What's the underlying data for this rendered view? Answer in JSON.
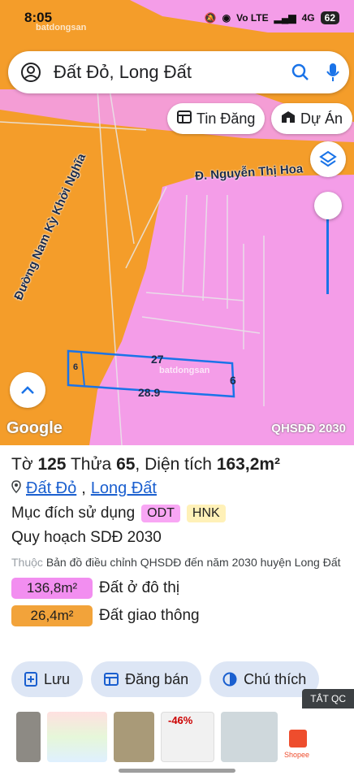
{
  "status_bar": {
    "time": "8:05",
    "network": "Vo LTE",
    "signal": "4G",
    "battery": "62"
  },
  "search": {
    "query": "Đất Đỏ, Long Đất"
  },
  "chips": {
    "listings": "Tin Đăng",
    "projects": "Dự Án"
  },
  "map": {
    "street_1": "Đ. Nguyễn Thị Hoa",
    "street_2": "Đường Nam Kỳ Khởi Nghĩa",
    "dim_top": "27",
    "dim_bottom": "28.9",
    "dim_right": "6",
    "dim_left": "6",
    "watermark": "batdongsan",
    "google": "Google",
    "source": "QHSDĐ 2030",
    "colors": {
      "urban_land": "#f49de8",
      "transport_land": "#f49d2a",
      "parcel_outline": "#1a73e8"
    }
  },
  "parcel": {
    "sheet_label": "Tờ",
    "sheet": "125",
    "plot_label": "Thửa",
    "plot": "65",
    "area_label": "Diện tích",
    "area": "163,2m²",
    "district": "Đất Đỏ",
    "town": "Long Đất",
    "purpose_label": "Mục đích sử dụng",
    "purpose_tags": [
      "ODT",
      "HNK"
    ],
    "plan_title": "Quy hoạch SDĐ 2030",
    "note_prefix": "Thuộc",
    "note": "Bản đồ điều chỉnh QHSDĐ đến năm 2030 huyện Long Đất",
    "areas": [
      {
        "value": "136,8m²",
        "label": "Đất ở đô thị"
      },
      {
        "value": "26,4m²",
        "label": "Đất giao thông"
      }
    ]
  },
  "actions": {
    "save": "Lưu",
    "post_sale": "Đăng bán",
    "legend": "Chú thích"
  },
  "ads": {
    "close_label": "TẮT QC",
    "discount": "-46%",
    "brand": "Shopee"
  }
}
